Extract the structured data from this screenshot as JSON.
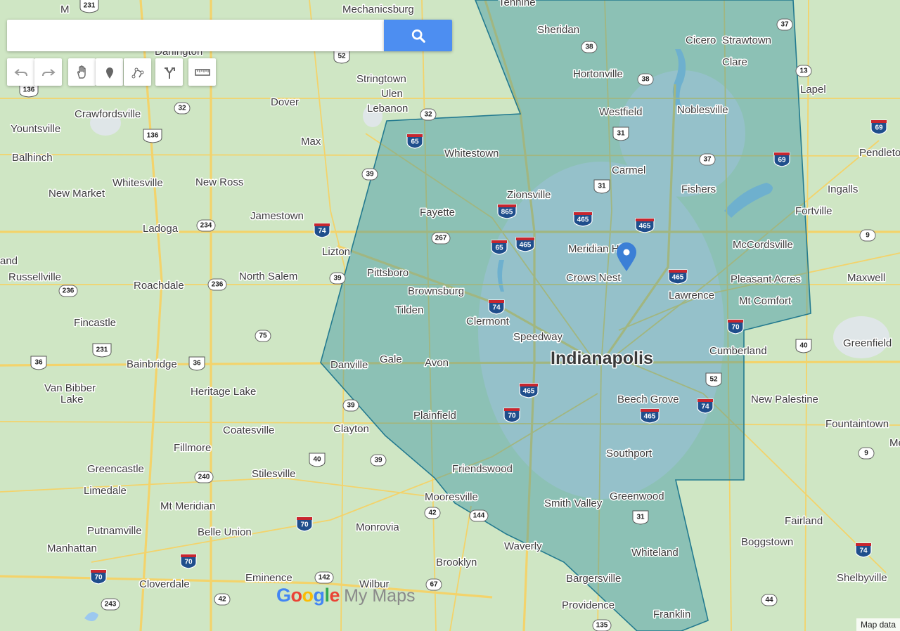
{
  "search": {
    "placeholder": "",
    "value": ""
  },
  "toolbar": [
    {
      "name": "undo-button",
      "icon": "undo-icon"
    },
    {
      "name": "redo-button",
      "icon": "redo-icon"
    },
    {
      "name": "pan-button",
      "icon": "hand-icon"
    },
    {
      "name": "add-marker-button",
      "icon": "marker-icon"
    },
    {
      "name": "draw-line-button",
      "icon": "polyline-icon"
    },
    {
      "name": "directions-button",
      "icon": "route-icon"
    },
    {
      "name": "measure-button",
      "icon": "ruler-icon"
    }
  ],
  "branding": {
    "google": "Google",
    "product": "My Maps"
  },
  "attribution": "Map data",
  "colors": {
    "region_fill": "#2f8fa0",
    "region_stroke": "#237a8f",
    "marker": "#3b7fd6",
    "search_button": "#4d8ef1",
    "highway_shield": "#1f4e8c"
  },
  "places": [
    {
      "name": "Mechanicsburg",
      "major": false
    },
    {
      "name": "Tennine",
      "major": false
    },
    {
      "name": "Sheridan",
      "major": false
    },
    {
      "name": "Cicero",
      "major": false
    },
    {
      "name": "Strawtown",
      "major": false
    },
    {
      "name": "Darlington",
      "major": false
    },
    {
      "name": "Stringtown",
      "major": false
    },
    {
      "name": "Ulen",
      "major": false
    },
    {
      "name": "Lebanon",
      "major": false
    },
    {
      "name": "Hortonville",
      "major": false
    },
    {
      "name": "Clare",
      "major": false
    },
    {
      "name": "Lapel",
      "major": false
    },
    {
      "name": "Crawfordsville",
      "major": false
    },
    {
      "name": "Dover",
      "major": false
    },
    {
      "name": "Westfield",
      "major": false
    },
    {
      "name": "Noblesville",
      "major": false
    },
    {
      "name": "Yountsville",
      "major": false
    },
    {
      "name": "Max",
      "major": false
    },
    {
      "name": "Pendleton",
      "major": false
    },
    {
      "name": "Balhinch",
      "major": false
    },
    {
      "name": "Whitestown",
      "major": false
    },
    {
      "name": "Carmel",
      "major": false
    },
    {
      "name": "Whitesville",
      "major": false
    },
    {
      "name": "New Ross",
      "major": false
    },
    {
      "name": "New Market",
      "major": false
    },
    {
      "name": "Zionsville",
      "major": false
    },
    {
      "name": "Fishers",
      "major": false
    },
    {
      "name": "Ingalls",
      "major": false
    },
    {
      "name": "Fayette",
      "major": false
    },
    {
      "name": "Fortville",
      "major": false
    },
    {
      "name": "Jamestown",
      "major": false
    },
    {
      "name": "Ladoga",
      "major": false
    },
    {
      "name": "Meridian Hills",
      "major": false
    },
    {
      "name": "McCordsville",
      "major": false
    },
    {
      "name": "Lizton",
      "major": false
    },
    {
      "name": "and",
      "major": false
    },
    {
      "name": "Pittsboro",
      "major": false
    },
    {
      "name": "Crows Nest",
      "major": false
    },
    {
      "name": "Russellville",
      "major": false
    },
    {
      "name": "North Salem",
      "major": false
    },
    {
      "name": "Maxwell",
      "major": false
    },
    {
      "name": "Pleasant Acres",
      "major": false
    },
    {
      "name": "Roachdale",
      "major": false
    },
    {
      "name": "Brownsburg",
      "major": false
    },
    {
      "name": "Lawrence",
      "major": false
    },
    {
      "name": "Mt Comfort",
      "major": false
    },
    {
      "name": "Tilden",
      "major": false
    },
    {
      "name": "Fincastle",
      "major": false
    },
    {
      "name": "Clermont",
      "major": false
    },
    {
      "name": "Speedway",
      "major": false
    },
    {
      "name": "Greenfield",
      "major": false
    },
    {
      "name": "Cumberland",
      "major": false
    },
    {
      "name": "Indianapolis",
      "major": true
    },
    {
      "name": "Gale",
      "major": false
    },
    {
      "name": "Bainbridge",
      "major": false
    },
    {
      "name": "Danville",
      "major": false
    },
    {
      "name": "Avon",
      "major": false
    },
    {
      "name": "Van Bibber",
      "major": false
    },
    {
      "name": "Lake",
      "major": false
    },
    {
      "name": "Heritage Lake",
      "major": false
    },
    {
      "name": "Beech Grove",
      "major": false
    },
    {
      "name": "New Palestine",
      "major": false
    },
    {
      "name": "Plainfield",
      "major": false
    },
    {
      "name": "Fountaintown",
      "major": false
    },
    {
      "name": "Clayton",
      "major": false
    },
    {
      "name": "Coatesville",
      "major": false
    },
    {
      "name": "Fillmore",
      "major": false
    },
    {
      "name": "Southport",
      "major": false
    },
    {
      "name": "Greencastle",
      "major": false
    },
    {
      "name": "Friendswood",
      "major": false
    },
    {
      "name": "Stilesville",
      "major": false
    },
    {
      "name": "Limedale",
      "major": false
    },
    {
      "name": "Mooresville",
      "major": false
    },
    {
      "name": "Greenwood",
      "major": false
    },
    {
      "name": "Mt Meridian",
      "major": false
    },
    {
      "name": "Smith Valley",
      "major": false
    },
    {
      "name": "Fairland",
      "major": false
    },
    {
      "name": "Putnamville",
      "major": false
    },
    {
      "name": "Belle Union",
      "major": false
    },
    {
      "name": "Monrovia",
      "major": false
    },
    {
      "name": "Manhattan",
      "major": false
    },
    {
      "name": "Waverly",
      "major": false
    },
    {
      "name": "Boggstown",
      "major": false
    },
    {
      "name": "Whiteland",
      "major": false
    },
    {
      "name": "Brooklyn",
      "major": false
    },
    {
      "name": "Eminence",
      "major": false
    },
    {
      "name": "Wilbur",
      "major": false
    },
    {
      "name": "Cloverdale",
      "major": false
    },
    {
      "name": "Bargersville",
      "major": false
    },
    {
      "name": "Shelbyville",
      "major": false
    },
    {
      "name": "Providence",
      "major": false
    },
    {
      "name": "Franklin",
      "major": false
    },
    {
      "name": "M",
      "major": false
    },
    {
      "name": "Me",
      "major": false
    }
  ],
  "shields": [
    {
      "label": "231",
      "kind": "us"
    },
    {
      "label": "52",
      "kind": "us"
    },
    {
      "label": "38",
      "kind": "state"
    },
    {
      "label": "37",
      "kind": "state"
    },
    {
      "label": "136",
      "kind": "us"
    },
    {
      "label": "38",
      "kind": "state"
    },
    {
      "label": "13",
      "kind": "state"
    },
    {
      "label": "32",
      "kind": "state"
    },
    {
      "label": "32",
      "kind": "state"
    },
    {
      "label": "31",
      "kind": "us"
    },
    {
      "label": "136",
      "kind": "us"
    },
    {
      "label": "65",
      "kind": "interstate"
    },
    {
      "label": "69",
      "kind": "interstate"
    },
    {
      "label": "69",
      "kind": "interstate"
    },
    {
      "label": "37",
      "kind": "state"
    },
    {
      "label": "39",
      "kind": "state"
    },
    {
      "label": "31",
      "kind": "us"
    },
    {
      "label": "865",
      "kind": "interstate"
    },
    {
      "label": "465",
      "kind": "interstate"
    },
    {
      "label": "465",
      "kind": "interstate"
    },
    {
      "label": "234",
      "kind": "state"
    },
    {
      "label": "74",
      "kind": "interstate"
    },
    {
      "label": "267",
      "kind": "state"
    },
    {
      "label": "9",
      "kind": "state"
    },
    {
      "label": "65",
      "kind": "interstate"
    },
    {
      "label": "465",
      "kind": "interstate"
    },
    {
      "label": "39",
      "kind": "state"
    },
    {
      "label": "465",
      "kind": "interstate"
    },
    {
      "label": "236",
      "kind": "state"
    },
    {
      "label": "236",
      "kind": "state"
    },
    {
      "label": "74",
      "kind": "interstate"
    },
    {
      "label": "70",
      "kind": "interstate"
    },
    {
      "label": "75",
      "kind": "state"
    },
    {
      "label": "40",
      "kind": "us"
    },
    {
      "label": "231",
      "kind": "us"
    },
    {
      "label": "36",
      "kind": "us"
    },
    {
      "label": "36",
      "kind": "us"
    },
    {
      "label": "465",
      "kind": "interstate"
    },
    {
      "label": "52",
      "kind": "us"
    },
    {
      "label": "74",
      "kind": "interstate"
    },
    {
      "label": "39",
      "kind": "state"
    },
    {
      "label": "70",
      "kind": "interstate"
    },
    {
      "label": "465",
      "kind": "interstate"
    },
    {
      "label": "9",
      "kind": "state"
    },
    {
      "label": "40",
      "kind": "us"
    },
    {
      "label": "39",
      "kind": "state"
    },
    {
      "label": "240",
      "kind": "state"
    },
    {
      "label": "42",
      "kind": "state"
    },
    {
      "label": "144",
      "kind": "state"
    },
    {
      "label": "31",
      "kind": "us"
    },
    {
      "label": "70",
      "kind": "interstate"
    },
    {
      "label": "74",
      "kind": "interstate"
    },
    {
      "label": "70",
      "kind": "interstate"
    },
    {
      "label": "70",
      "kind": "interstate"
    },
    {
      "label": "142",
      "kind": "state"
    },
    {
      "label": "67",
      "kind": "state"
    },
    {
      "label": "42",
      "kind": "state"
    },
    {
      "label": "243",
      "kind": "state"
    },
    {
      "label": "44",
      "kind": "state"
    },
    {
      "label": "135",
      "kind": "state"
    }
  ]
}
